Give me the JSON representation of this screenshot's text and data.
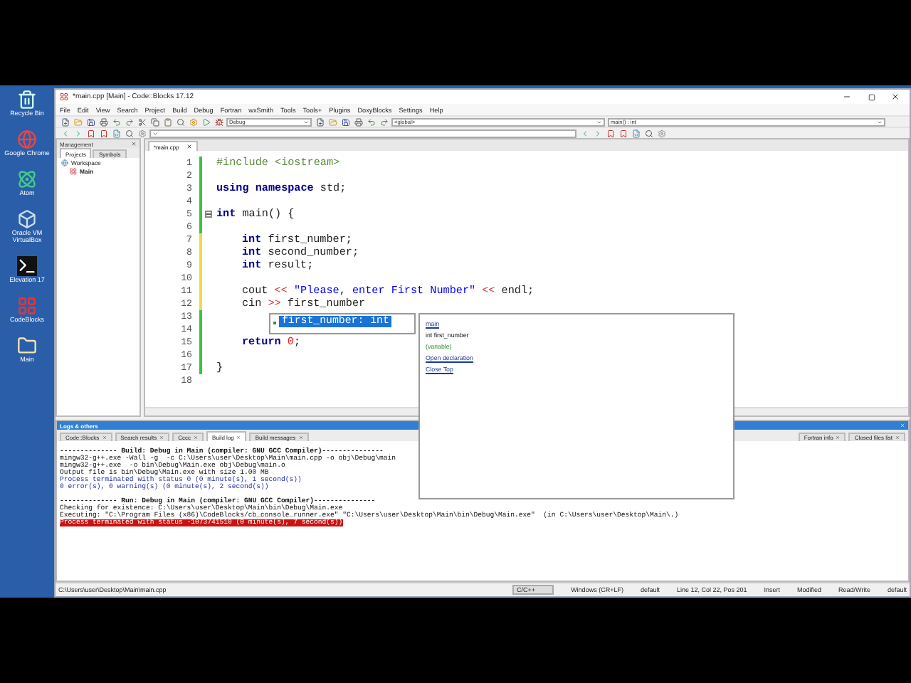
{
  "desktop": {
    "icons": [
      {
        "label": "Recycle Bin",
        "kind": "bin"
      },
      {
        "label": "Google Chrome",
        "kind": "browser"
      },
      {
        "label": "Atom",
        "kind": "atom"
      },
      {
        "label": "Oracle VM VirtualBox",
        "kind": "box"
      },
      {
        "label": "Elevation 17",
        "kind": "terminal"
      },
      {
        "label": "CodeBlocks",
        "kind": "blocks"
      },
      {
        "label": "Main",
        "kind": "folder"
      }
    ]
  },
  "window": {
    "title": "*main.cpp [Main] - Code::Blocks 17.12"
  },
  "menu": [
    "File",
    "Edit",
    "View",
    "Search",
    "Project",
    "Build",
    "Debug",
    "Fortran",
    "wxSmith",
    "Tools",
    "Tools+",
    "Plugins",
    "DoxyBlocks",
    "Settings",
    "Help"
  ],
  "toolbar": {
    "build_target": "Debug",
    "scope": "<global>",
    "function": "main() : int"
  },
  "management": {
    "title": "Management",
    "tabs": [
      {
        "label": "Projects",
        "selected": true
      },
      {
        "label": "Symbols",
        "selected": false
      }
    ],
    "tree": [
      {
        "label": "Workspace",
        "children": [
          {
            "label": "Main"
          }
        ]
      }
    ]
  },
  "editor": {
    "tab": "*main.cpp",
    "lines": [
      {
        "number": "1",
        "color": "#3cc33c",
        "fold": false,
        "tokens": [
          {
            "kind": "preproc",
            "text": "#include <iostream>"
          }
        ]
      },
      {
        "number": "2",
        "color": "#3cc33c",
        "fold": false
      },
      {
        "number": "3",
        "color": "#3cc33c",
        "fold": false,
        "tokens": [
          {
            "kind": "keyword",
            "text": "using namespace"
          },
          {
            "kind": "plain",
            "text": " std;"
          }
        ]
      },
      {
        "number": "4",
        "color": "#3cc33c",
        "fold": false
      },
      {
        "number": "5",
        "color": "#3cc33c",
        "fold": true,
        "tokens": [
          {
            "kind": "keyword",
            "text": "int"
          },
          {
            "kind": "plain",
            "text": " main() {"
          }
        ],
        "children": [
          {
            "number": "6",
            "color": "#3cc33c",
            "fold": false
          },
          {
            "number": "7",
            "color": "#f0dc40",
            "fold": false,
            "tokens": [
              {
                "kind": "keyword",
                "text": "int"
              },
              {
                "kind": "plain",
                "text": " first_number;"
              }
            ]
          },
          {
            "number": "8",
            "color": "#f0dc40",
            "fold": false,
            "tokens": [
              {
                "kind": "keyword",
                "text": "int"
              },
              {
                "kind": "plain",
                "text": " second_number;"
              }
            ]
          },
          {
            "number": "9",
            "color": "#f0dc40",
            "fold": false,
            "tokens": [
              {
                "kind": "keyword",
                "text": "int"
              },
              {
                "kind": "plain",
                "text": " result;"
              }
            ]
          },
          {
            "number": "10",
            "color": "#f0dc40",
            "fold": false
          },
          {
            "number": "11",
            "color": "#f0dc40",
            "fold": false,
            "tokens": [
              {
                "kind": "plain",
                "text": "cout"
              },
              {
                "kind": "operator",
                "text": " <<"
              },
              {
                "kind": "string",
                "text": " \"Please, enter First Number\""
              },
              {
                "kind": "operator",
                "text": " <<"
              },
              {
                "kind": "plain",
                "text": " endl;"
              }
            ]
          },
          {
            "number": "12",
            "color": "#f0dc40",
            "fold": false,
            "tokens": [
              {
                "kind": "plain",
                "text": "cin"
              },
              {
                "kind": "operator",
                "text": " >>"
              },
              {
                "kind": "plain",
                "text": " first_number"
              }
            ]
          },
          {
            "number": "13",
            "color": "#3cc33c",
            "fold": false
          },
          {
            "number": "14",
            "color": "#3cc33c",
            "fold": false
          },
          {
            "number": "15",
            "color": "#3cc33c",
            "fold": false,
            "tokens": [
              {
                "kind": "keyword",
                "text": "return"
              },
              {
                "kind": "number",
                "text": " 0"
              },
              {
                "kind": "plain",
                "text": ";"
              }
            ]
          },
          {
            "number": "16",
            "color": "#3cc33c",
            "fold": false
          }
        ]
      },
      {
        "number": "17",
        "color": "#3cc33c",
        "fold": false,
        "tokens": [
          {
            "kind": "plain",
            "text": "}"
          }
        ]
      },
      {
        "number": "18",
        "fold": false
      }
    ]
  },
  "autocomplete": {
    "items": [
      {
        "label": "first_number: int",
        "selected": true
      }
    ],
    "doc": {
      "scope": "main",
      "signature": "int first_number",
      "category": "(variable)",
      "links": [
        "Open declaration",
        "Close Top"
      ]
    }
  },
  "logs": {
    "title": "Logs & others",
    "tabs": [
      {
        "label": "Code::Blocks",
        "selected": false
      },
      {
        "label": "Search results",
        "selected": false
      },
      {
        "label": "Cccc",
        "selected": false
      },
      {
        "label": "Build log",
        "selected": true
      },
      {
        "label": "Build messages",
        "selected": false
      }
    ],
    "tabs_right": [
      {
        "label": "Fortran info",
        "selected": false
      },
      {
        "label": "Closed files list",
        "selected": false
      }
    ],
    "sections": [
      {
        "lines": [
          {
            "kind": "header",
            "text": "-------------- Build: Debug in Main (compiler: GNU GCC Compiler)---------------"
          },
          {
            "kind": "plain",
            "text": "mingw32-g++.exe -Wall -g  -c C:\\Users\\user\\Desktop\\Main\\main.cpp -o obj\\Debug\\main"
          },
          {
            "kind": "plain",
            "text": "mingw32-g++.exe  -o bin\\Debug\\Main.exe obj\\Debug\\main.o"
          },
          {
            "kind": "plain",
            "text": "Output file is bin\\Debug\\Main.exe with size 1.00 MB"
          },
          {
            "kind": "info",
            "text": "Process terminated with status 0 (0 minute(s), 1 second(s))"
          },
          {
            "kind": "info",
            "text": "0 error(s), 0 warning(s) (0 minute(s), 2 second(s))"
          }
        ]
      },
      {
        "lines": [
          {
            "kind": "header",
            "text": "-------------- Run: Debug in Main (compiler: GNU GCC Compiler)---------------"
          },
          {
            "kind": "plain",
            "text": "Checking for existence: C:\\Users\\user\\Desktop\\Main\\bin\\Debug\\Main.exe"
          },
          {
            "kind": "plain",
            "text": "Executing: \"C:\\Program Files (x86)\\CodeBlocks/cb_console_runner.exe\" \"C:\\Users\\user\\Desktop\\Main\\bin\\Debug\\Main.exe\"  (in C:\\Users\\user\\Desktop\\Main\\.)"
          },
          {
            "kind": "error",
            "text": "Process terminated with status -1073741510 (0 minute(s), 7 second(s))"
          }
        ]
      }
    ]
  },
  "status_bar": {
    "path": "C:\\Users\\user\\Desktop\\Main\\main.cpp",
    "items": [
      "C/C++",
      "Windows (CR+LF)",
      "default",
      "Line 12, Col 22, Pos 201",
      "Insert",
      "Modified",
      "Read/Write",
      "default"
    ]
  }
}
